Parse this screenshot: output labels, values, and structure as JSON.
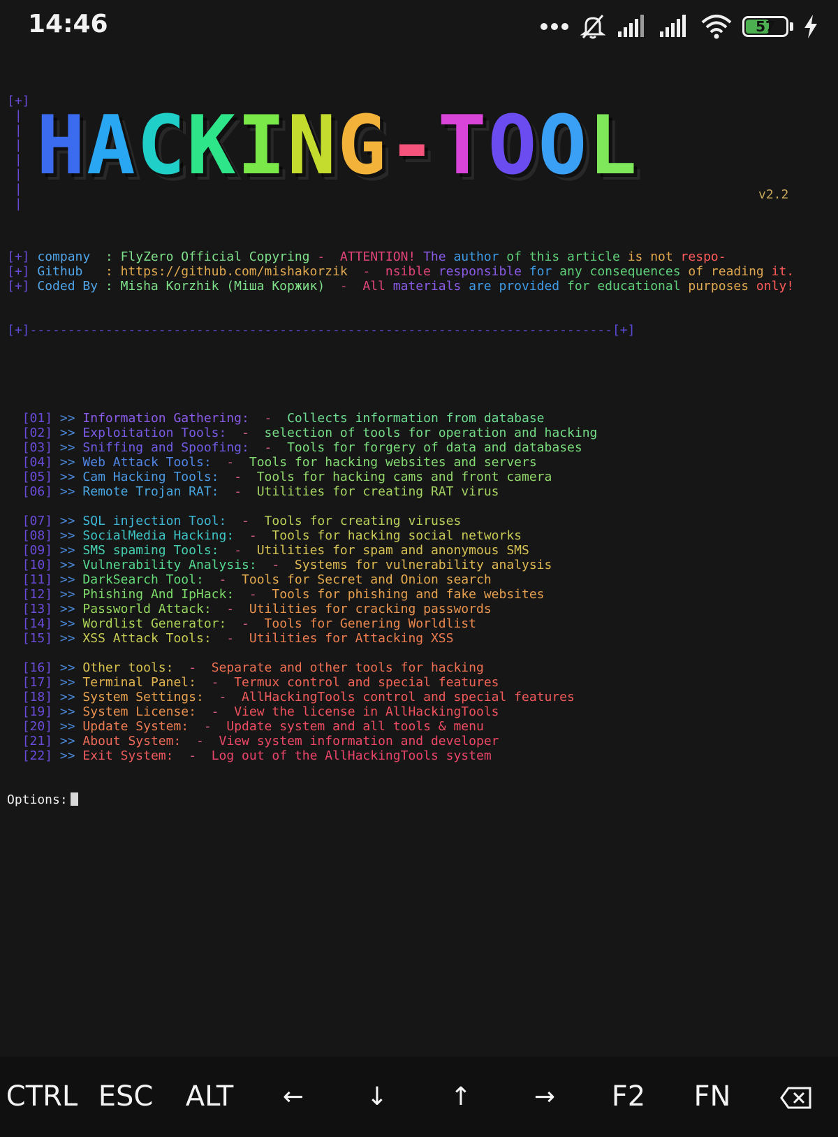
{
  "status_bar": {
    "time": "14:46",
    "battery_level": "57",
    "battery_fraction": 0.57,
    "icons": [
      "more-dots-icon",
      "bell-off-icon",
      "signal-icon",
      "signal-icon",
      "wifi-icon",
      "battery-icon",
      "charging-icon"
    ]
  },
  "banner": {
    "frame_top": "[+]",
    "title": "HACKING-TOOL",
    "title_colors": [
      "#3b6cf0",
      "#2aa7f2",
      "#1fcfc8",
      "#2ee58a",
      "#7be84a",
      "#c4dc2e",
      "#f3b23a",
      "#f5537c",
      "#d944d9",
      "#6a4cf0",
      "#3aa0f5",
      "#7ee85a"
    ],
    "version": "v2.2"
  },
  "info": {
    "lines": [
      {
        "bracket": "[+]",
        "key": "company  ",
        "value": ": FlyZero Official Copyring",
        "dash": " -  ",
        "note": [
          "ATTENTION!",
          " The",
          " author",
          " of this article",
          " is not",
          " respo-"
        ]
      },
      {
        "bracket": "[+]",
        "key": "Github   ",
        "value": ": https://github.com/mishakorzik",
        "dash": "  -  ",
        "note": [
          "nsible",
          " responsible",
          " for",
          " any consequences",
          " of reading",
          " it."
        ]
      },
      {
        "bracket": "[+]",
        "key": "Coded By ",
        "value": ": Misha Korzhik (Міша Коржик)",
        "dash": "  -  ",
        "note": [
          "All",
          " materials",
          " are provided",
          " for educational",
          " purposes",
          " only!"
        ]
      }
    ],
    "separator": "[+]-----------------------------------------------------------------------------[+]"
  },
  "menu": {
    "groups": [
      [
        {
          "num": "[01]",
          "label": "Information Gathering:",
          "desc": "Collects information from database"
        },
        {
          "num": "[02]",
          "label": "Exploitation Tools:",
          "desc": "selection of tools for operation and hacking"
        },
        {
          "num": "[03]",
          "label": "Sniffing and Spoofing:",
          "desc": "Tools for forgery of data and databases"
        },
        {
          "num": "[04]",
          "label": "Web Attack Tools:",
          "desc": "Tools for hacking websites and servers"
        },
        {
          "num": "[05]",
          "label": "Cam Hacking Tools:",
          "desc": "Tools for hacking cams and front camera"
        },
        {
          "num": "[06]",
          "label": "Remote Trojan RAT:",
          "desc": "Utilities for creating RAT virus"
        }
      ],
      [
        {
          "num": "[07]",
          "label": "SQL injection Tool:",
          "desc": "Tools for creating viruses"
        },
        {
          "num": "[08]",
          "label": "SocialMedia Hacking:",
          "desc": "Tools for hacking social networks"
        },
        {
          "num": "[09]",
          "label": "SMS spaming Tools:",
          "desc": "Utilities for spam and anonymous SMS"
        },
        {
          "num": "[10]",
          "label": "Vulnerability Analysis:",
          "desc": "Systems for vulnerability analysis"
        },
        {
          "num": "[11]",
          "label": "DarkSearch Tool:",
          "desc": "Tools for Secret and Onion search"
        },
        {
          "num": "[12]",
          "label": "Phishing And IpHack:",
          "desc": "Tools for phishing and fake websites"
        },
        {
          "num": "[13]",
          "label": "Passworld Attack:",
          "desc": "Utilities for cracking passwords"
        },
        {
          "num": "[14]",
          "label": "Wordlist Generator:",
          "desc": "Tools for Genering Worldlist"
        },
        {
          "num": "[15]",
          "label": "XSS Attack Tools:",
          "desc": "Utilities for Attacking XSS"
        }
      ],
      [
        {
          "num": "[16]",
          "label": "Other tools:",
          "desc": "Separate and other tools for hacking"
        },
        {
          "num": "[17]",
          "label": "Terminal Panel:",
          "desc": "Termux control and special features"
        },
        {
          "num": "[18]",
          "label": "System Settings:",
          "desc": "AllHackingTools control and special features"
        },
        {
          "num": "[19]",
          "label": "System License:",
          "desc": "View the license in AllHackingTools"
        },
        {
          "num": "[20]",
          "label": "Update System:",
          "desc": "Update system and all tools & menu"
        },
        {
          "num": "[21]",
          "label": "About System:",
          "desc": "View system information and developer"
        },
        {
          "num": "[22]",
          "label": "Exit System:",
          "desc": "Log out of the AllHackingTools system"
        }
      ]
    ],
    "arrow": ">>",
    "dash": "-",
    "label_colors": [
      "#8a5be8",
      "#7a5ae6",
      "#6f5ce6",
      "#4f86e6",
      "#4a9ae6",
      "#4aa7e0",
      "#3fb8d8",
      "#3ec6c6",
      "#46d0b0",
      "#54d890",
      "#66dc7a",
      "#7ddc6a",
      "#96d85e",
      "#aed456",
      "#c6cc52",
      "#d8c250",
      "#e3b450",
      "#e8a24e",
      "#ea904e",
      "#ec7c52",
      "#ee6a58",
      "#ef5a5e"
    ],
    "desc_colors": [
      "#6ddc90",
      "#74dc86",
      "#7adc7c",
      "#84da72",
      "#92d86a",
      "#a6d462",
      "#b8d05a",
      "#c8ca56",
      "#d6c254",
      "#dfb852",
      "#e5ac50",
      "#e8a04e",
      "#ea944e",
      "#ec884e",
      "#ee7c50",
      "#ef7052",
      "#f06456",
      "#f05a5a",
      "#ef525e",
      "#ee4c62",
      "#ec4866",
      "#ea446a"
    ]
  },
  "prompt": {
    "label": "Options:"
  },
  "keybar": {
    "keys": [
      {
        "name": "ctrl-key",
        "label": "CTRL"
      },
      {
        "name": "esc-key",
        "label": "ESC"
      },
      {
        "name": "alt-key",
        "label": "ALT"
      },
      {
        "name": "left-arrow-key",
        "label": "←"
      },
      {
        "name": "down-arrow-key",
        "label": "↓"
      },
      {
        "name": "up-arrow-key",
        "label": "↑"
      },
      {
        "name": "right-arrow-key",
        "label": "→"
      },
      {
        "name": "f2-key",
        "label": "F2"
      },
      {
        "name": "fn-key",
        "label": "FN"
      }
    ]
  }
}
